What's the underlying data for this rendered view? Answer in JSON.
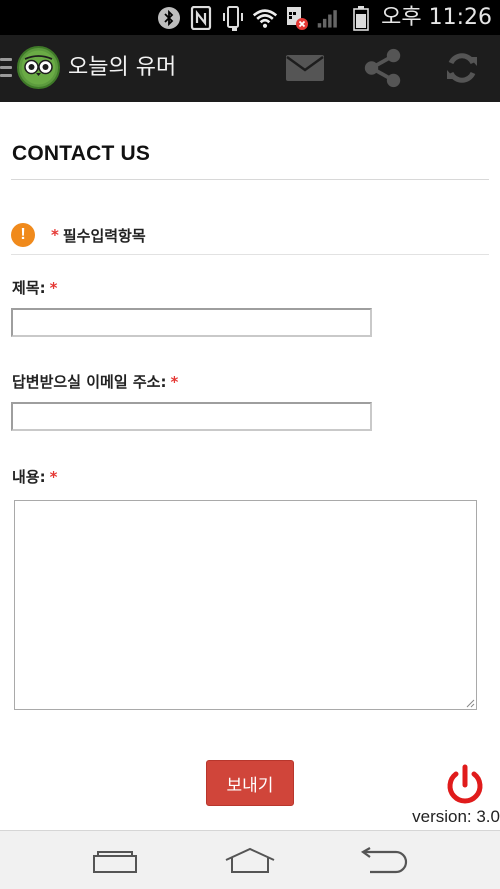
{
  "status_bar": {
    "icons": [
      "bluetooth-icon",
      "nfc-icon",
      "vibrate-icon",
      "wifi-icon",
      "sim-error-icon",
      "signal-icon",
      "battery-icon"
    ],
    "time": "오후 11:26"
  },
  "app_bar": {
    "title": "오늘의 유머",
    "actions": [
      "mail-icon",
      "share-icon",
      "refresh-icon"
    ]
  },
  "page": {
    "title": "CONTACT US",
    "required_mark": "*",
    "required_note": "필수입력항목",
    "fields": {
      "subject_label": "제목:",
      "subject_value": "",
      "email_label": "답변받으실 이메일 주소:",
      "email_value": "",
      "body_label": "내용:",
      "body_value": ""
    },
    "send_label": "보내기",
    "version": "version: 3.0"
  },
  "colors": {
    "accent_red": "#d0453a",
    "required_star": "#e53935",
    "warning": "#f08a1c",
    "app_bar": "#1d1d1d"
  },
  "nav_bar": {
    "buttons": [
      "recent-apps-icon",
      "home-icon",
      "back-icon"
    ]
  }
}
